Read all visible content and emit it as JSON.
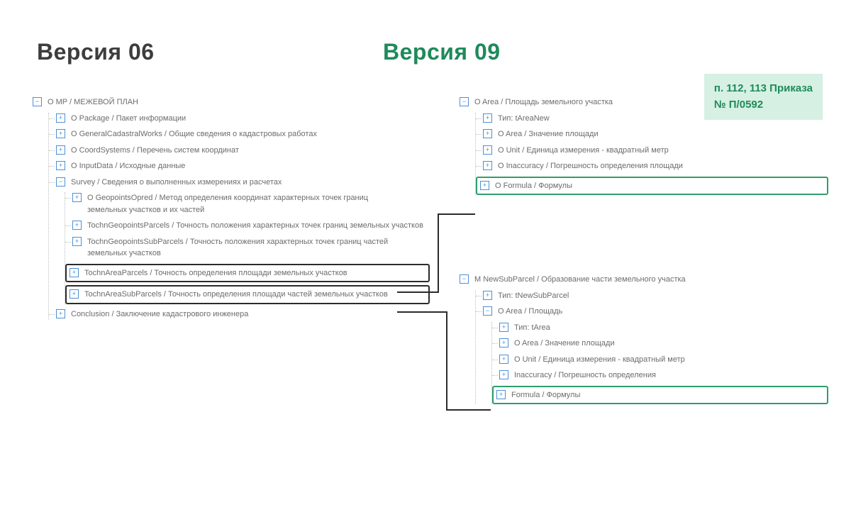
{
  "headings": {
    "left": "Версия 06",
    "right": "Версия 09"
  },
  "note": {
    "line1": "п. 112, 113 Приказа",
    "line2": "№ П/0592"
  },
  "left_tree": {
    "root": "O MP / МЕЖЕВОЙ ПЛАН",
    "items": [
      "O Package / Пакет информации",
      "O GeneralCadastralWorks / Общие сведения о кадастровых работах",
      "O CoordSystems / Перечень систем координат",
      "O InputData / Исходные данные"
    ],
    "survey": {
      "label": "Survey / Сведения о выполненных измерениях и расчетах",
      "children": [
        "O GeopointsOpred / Метод определения координат характерных точек границ земельных участков и их частей",
        "TochnGeopointsParcels / Точность положения характерных точек границ земельных участков",
        "TochnGeopointsSubParcels / Точность положения характерных точек границ частей земельных участков"
      ],
      "boxed1": "TochnAreaParcels / Точность определения площади земельных участков",
      "boxed2": "TochnAreaSubParcels / Точность определения площади частей земельных участков"
    },
    "conclusion": "Conclusion / Заключение кадастрового инженера"
  },
  "right_tree_1": {
    "root": "O Area / Площадь земельного участка",
    "items": [
      "Тип: tAreaNew",
      "O Area / Значение площади",
      "O Unit / Единица измерения - квадратный метр",
      "O Inaccuracy / Погрешность определения площади"
    ],
    "boxed": "O Formula / Формулы"
  },
  "right_tree_2": {
    "root": "M NewSubParcel / Образование части земельного участка",
    "sub1": "Тип: tNewSubParcel",
    "area": {
      "label": "O Area / Площадь",
      "items": [
        "Тип: tArea",
        "O Area / Значение площади",
        "O Unit / Единица измерения - квадратный метр",
        "Inaccuracy / Погрешность определения"
      ],
      "boxed": "Formula / Формулы"
    }
  }
}
